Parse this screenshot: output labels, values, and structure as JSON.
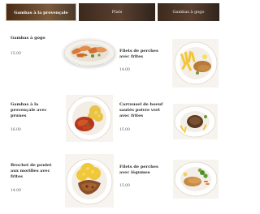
{
  "tabs": [
    {
      "label": "Gambas à la provençale",
      "active": true
    },
    {
      "label": "Plats",
      "active": false
    },
    {
      "label": "Gambas à gogo",
      "active": false
    }
  ],
  "items": [
    {
      "name": "Gambas à gogo",
      "price": "15.00"
    },
    {
      "name": "Gambas à la\nprovençale avec\nprunes",
      "price": "16.00"
    },
    {
      "name": "Brochet de poulet\naux morilles avec\nfrites",
      "price": "14.00"
    },
    {
      "name": "Filets de perches\navec frites",
      "price": "14.00"
    },
    {
      "name": "Carrousel de boeuf\nsautés poivre vert\navec frites",
      "price": "15.00"
    },
    {
      "name": "Filets de perches\navec légumes",
      "price": "15.00"
    }
  ],
  "colors": {
    "tab_bg": "#4a3424",
    "tab_text": "#f3eee8",
    "text": "#2a2a2a"
  }
}
